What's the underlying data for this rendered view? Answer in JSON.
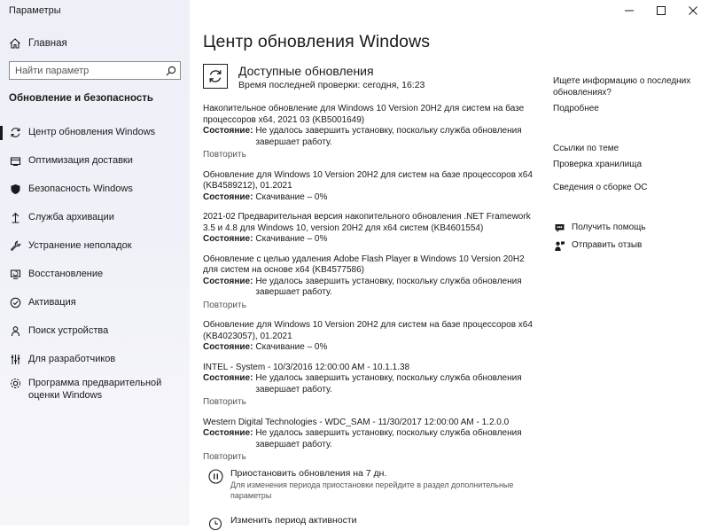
{
  "window": {
    "title": "Параметры"
  },
  "sidebar": {
    "home_label": "Главная",
    "search_placeholder": "Найти параметр",
    "section_title": "Обновление и безопасность",
    "items": [
      {
        "label": "Центр обновления Windows",
        "icon": "sync-icon"
      },
      {
        "label": "Оптимизация доставки",
        "icon": "delivery-icon"
      },
      {
        "label": "Безопасность Windows",
        "icon": "shield-icon"
      },
      {
        "label": "Служба архивации",
        "icon": "backup-icon"
      },
      {
        "label": "Устранение неполадок",
        "icon": "wrench-icon"
      },
      {
        "label": "Восстановление",
        "icon": "recovery-icon"
      },
      {
        "label": "Активация",
        "icon": "check-circle-icon"
      },
      {
        "label": "Поиск устройства",
        "icon": "person-pin-icon"
      },
      {
        "label": "Для разработчиков",
        "icon": "developer-icon"
      },
      {
        "label": "Программа предварительной оценки Windows",
        "icon": "insider-icon"
      }
    ]
  },
  "main": {
    "title": "Центр обновления Windows",
    "status": {
      "title": "Доступные обновления",
      "subtitle": "Время последней проверки: сегодня, 16:23"
    },
    "state_key": "Состояние:",
    "retry_label": "Повторить",
    "updates": [
      {
        "title": "Накопительное обновление для Windows 10 Version 20H2 для систем на базе процессоров x64, 2021 03 (KB5001649)",
        "state": "Не удалось завершить установку, поскольку служба обновления завершает работу.",
        "retry": true
      },
      {
        "title": "Обновление для Windows 10 Version 20H2 для систем на базе процессоров x64 (KB4589212), 01.2021",
        "state": "Скачивание – 0%",
        "retry": false
      },
      {
        "title": "2021-02 Предварительная версия накопительного обновления .NET Framework 3.5 и 4.8 для Windows 10, version 20H2 для x64 систем (KB4601554)",
        "state": "Скачивание – 0%",
        "retry": false
      },
      {
        "title": "Обновление с целью удаления Adobe Flash Player в Windows 10 Version 20H2 для систем на основе x64 (KB4577586)",
        "state": "Не удалось завершить установку, поскольку служба обновления завершает работу.",
        "retry": true
      },
      {
        "title": "Обновление для Windows 10 Version 20H2 для систем на базе процессоров x64 (KB4023057), 01.2021",
        "state": "Скачивание – 0%",
        "retry": false
      },
      {
        "title": "INTEL - System - 10/3/2016 12:00:00 AM - 10.1.1.38",
        "state": "Не удалось завершить установку, поскольку служба обновления завершает работу.",
        "retry": true
      },
      {
        "title": "Western Digital Technologies - WDC_SAM - 11/30/2017 12:00:00 AM - 1.2.0.0",
        "state": "Не удалось завершить установку, поскольку служба обновления завершает работу.",
        "retry": true
      }
    ],
    "options": [
      {
        "icon": "pause-icon",
        "title": "Приостановить обновления на 7 дн.",
        "desc": "Для изменения периода приостановки перейдите в раздел дополнительные параметры"
      },
      {
        "icon": "active-hours-icon",
        "title": "Изменить период активности",
        "desc": ""
      }
    ]
  },
  "right": {
    "info_title": "Ищете информацию о последних обновлениях?",
    "more_link": "Подробнее",
    "related_title": "Ссылки по теме",
    "links": [
      "Проверка хранилища",
      "Сведения о сборке ОС"
    ],
    "help_label": "Получить помощь",
    "feedback_label": "Отправить отзыв"
  }
}
